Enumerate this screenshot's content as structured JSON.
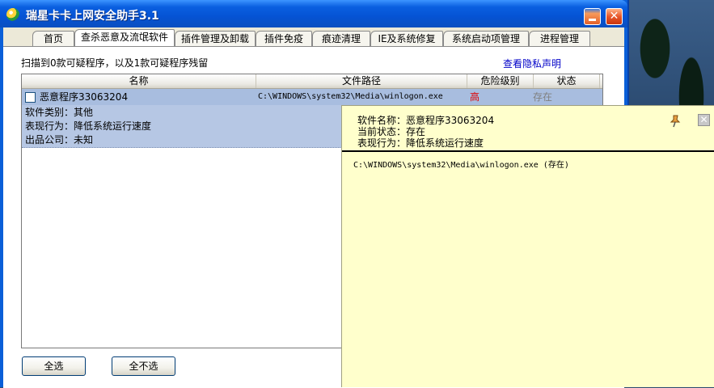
{
  "window": {
    "title": "瑞星卡卡上网安全助手3.1",
    "close_glyph": "✕"
  },
  "tabs": [
    {
      "label": "首页"
    },
    {
      "label": "查杀恶意及流氓软件"
    },
    {
      "label": "插件管理及卸载"
    },
    {
      "label": "插件免疫"
    },
    {
      "label": "痕迹清理"
    },
    {
      "label": "IE及系统修复"
    },
    {
      "label": "系统启动项管理"
    },
    {
      "label": "进程管理"
    }
  ],
  "main": {
    "scan_summary": "扫描到0款可疑程序，以及1款可疑程序残留",
    "privacy_link": "查看隐私声明"
  },
  "table": {
    "columns": [
      "名称",
      "文件路径",
      "危险级别",
      "状态"
    ],
    "rows": [
      {
        "name": "恶意程序33063204",
        "path": "C:\\WINDOWS\\system32\\Media\\winlogon.exe",
        "risk": "高",
        "status": "存在",
        "details": [
          "软件类别：其他",
          "表现行为：降低系统运行速度",
          "出品公司：未知"
        ]
      }
    ]
  },
  "buttons": {
    "select_all": "全选",
    "select_none": "全不选"
  },
  "popup": {
    "software_name": "软件名称：恶意程序33063204",
    "current_status": "当前状态：存在",
    "behavior": "表现行为：降低系统运行速度",
    "file_entry": "C:\\WINDOWS\\system32\\Media\\winlogon.exe  (存在)",
    "close_glyph": "✕"
  },
  "colors": {
    "risk_high": "#e00000",
    "status_gray": "#808080",
    "link_blue": "#0000c8",
    "popup_bg": "#ffffcc"
  }
}
